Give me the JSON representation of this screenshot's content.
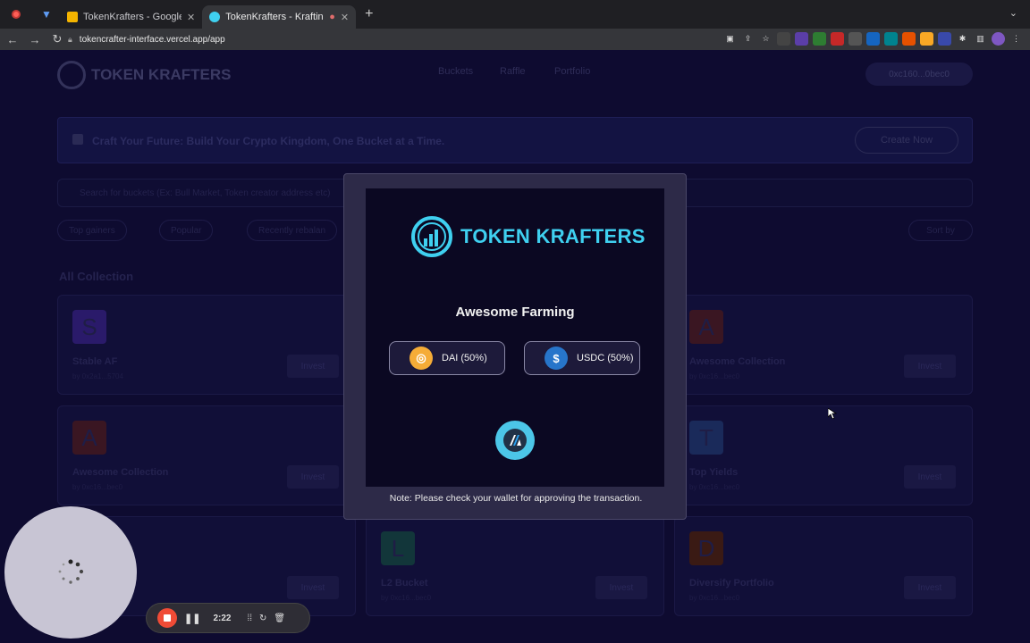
{
  "browser": {
    "tabs": [
      {
        "title": "TokenKrafters - Google Slides"
      },
      {
        "title": "TokenKrafters - Krafting Y"
      }
    ],
    "url": "tokencrafter-interface.vercel.app/app"
  },
  "app": {
    "brand": "TOKEN KRAFTERS",
    "nav": [
      "Buckets",
      "Raffle",
      "Portfolio"
    ],
    "wallet": "0xc160...0bec0",
    "banner": "Craft Your Future: Build Your Crypto Kingdom, One Bucket at a Time.",
    "create_label": "Create Now",
    "search_placeholder": "Search for buckets (Ex: Bull Market, Token creator address etc)",
    "filters": [
      "Top gainers",
      "Popular",
      "Recently rebalan"
    ],
    "sort_label": "Sort by",
    "collection_title": "All Collection",
    "invest_label": "Invest",
    "cards": [
      {
        "letter": "S",
        "name": "Stable AF",
        "by": "by 0x2a1...5704"
      },
      {
        "letter": "A",
        "name": "Awesome Collection",
        "by": "by 0xc16...bec0"
      },
      {
        "letter": "A",
        "name": "Awesome Collection",
        "by": "by 0xc16...bec0"
      },
      {
        "letter": "T",
        "name": "Top Yields",
        "by": "by 0xc16...bec0"
      },
      {
        "letter": "L",
        "name": "L2 Bucket",
        "by": "by 0xc16...bec0"
      },
      {
        "letter": "D",
        "name": "Diversify Portfolio",
        "by": "by 0xc16...bec0"
      }
    ]
  },
  "modal": {
    "brand": "TOKEN KRAFTERS",
    "bucket_name": "Awesome Farming",
    "tokens": [
      {
        "label": "DAI  (50%)",
        "icon": "dai-icon",
        "color": "#f5ac37"
      },
      {
        "label": "USDC  (50%)",
        "icon": "usdc-icon",
        "color": "#2775ca"
      }
    ],
    "note": "Note: Please check your wallet for approving the transaction."
  },
  "recorder": {
    "time": "2:22"
  }
}
